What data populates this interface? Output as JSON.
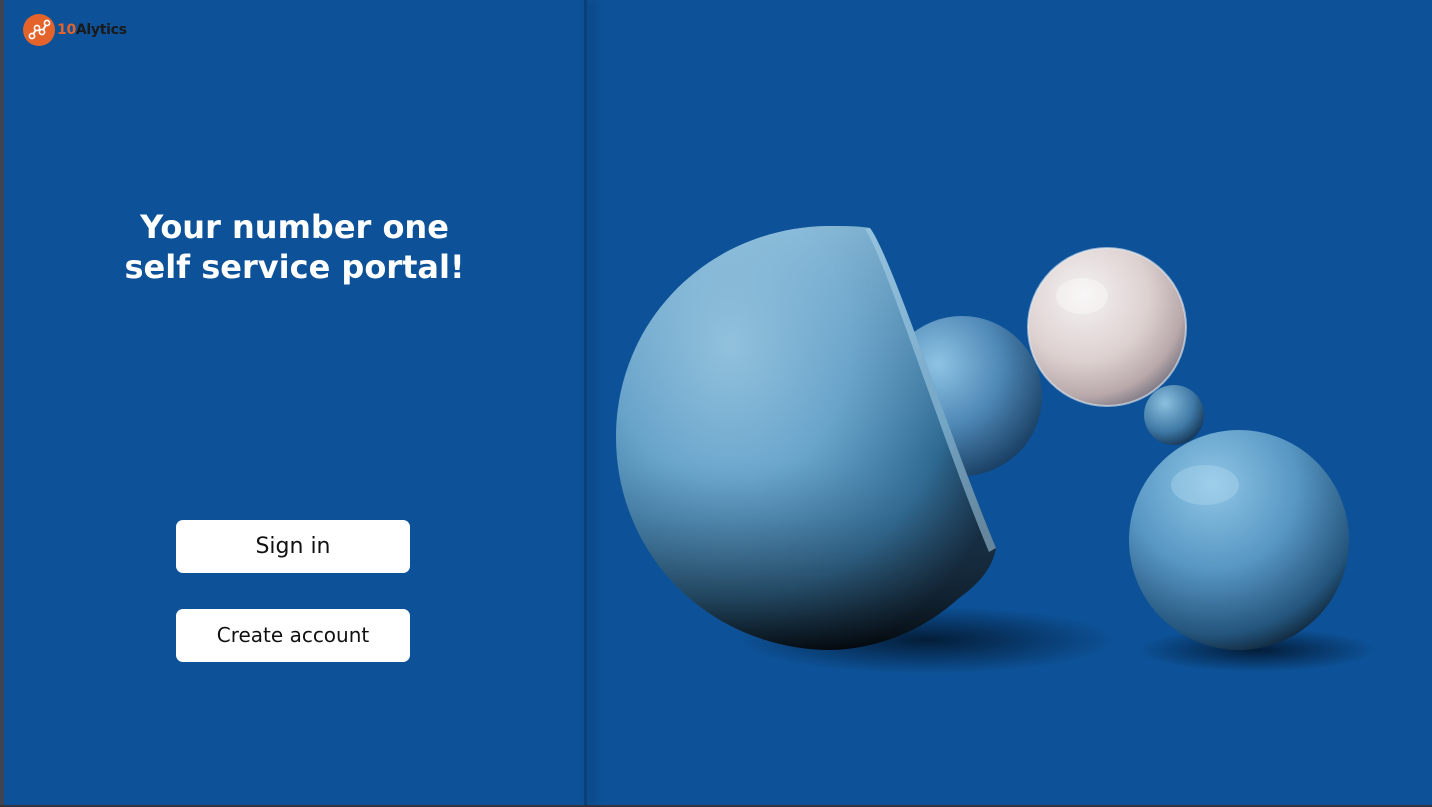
{
  "brand": {
    "logo_number": "10",
    "logo_name": "Alytics",
    "logo_color": "#e3632b"
  },
  "hero": {
    "headline_line1": "Your number one",
    "headline_line2": "self service portal!"
  },
  "actions": {
    "signin_label": "Sign in",
    "create_label": "Create account"
  },
  "colors": {
    "background": "#0d5298",
    "button_bg": "#ffffff",
    "text": "#ffffff"
  },
  "illustration": {
    "icon": "3d-spheres-illustration"
  }
}
